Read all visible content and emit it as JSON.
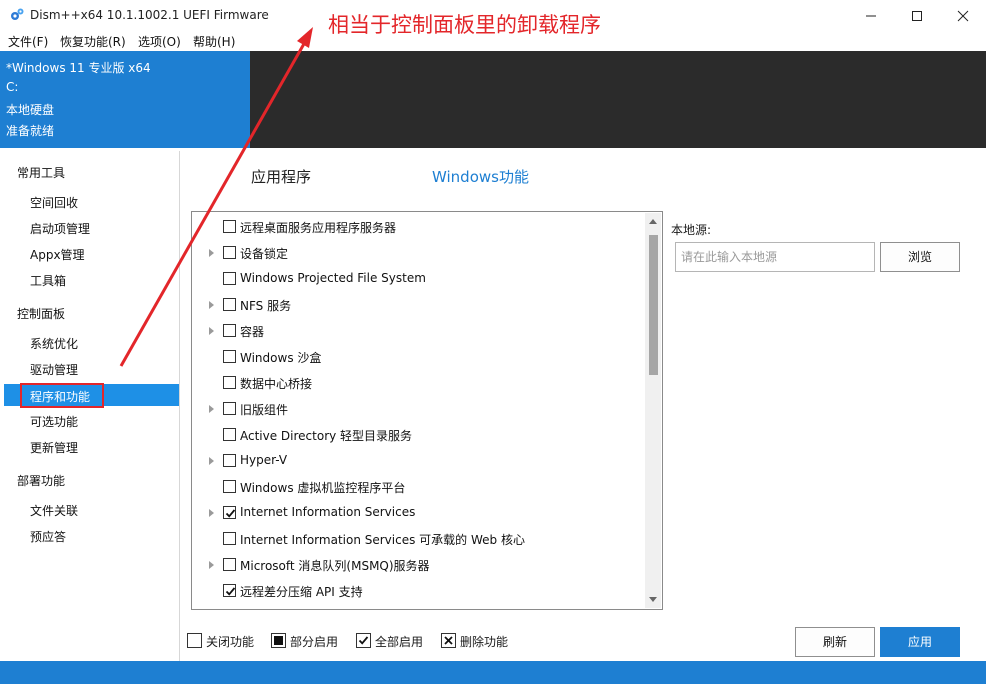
{
  "window": {
    "title": "Dism++x64 10.1.1002.1 UEFI Firmware",
    "icon": "gear-icon"
  },
  "menu": [
    "文件(F)",
    "恢复功能(R)",
    "选项(O)",
    "帮助(H)"
  ],
  "system_info": {
    "os": "*Windows 11 专业版 x64",
    "drive": "C:",
    "disk_type": "本地硬盘",
    "status": "准备就绪"
  },
  "sidebar": {
    "groups": [
      {
        "title": "常用工具",
        "items": [
          "空间回收",
          "启动项管理",
          "Appx管理",
          "工具箱"
        ]
      },
      {
        "title": "控制面板",
        "items": [
          "系统优化",
          "驱动管理",
          "程序和功能",
          "可选功能",
          "更新管理"
        ]
      },
      {
        "title": "部署功能",
        "items": [
          "文件关联",
          "预应答"
        ]
      }
    ],
    "active_item": "程序和功能"
  },
  "tabs": {
    "apps": "应用程序",
    "windows_features": "Windows功能"
  },
  "features": [
    {
      "label": "远程桌面服务应用程序服务器",
      "expandable": false,
      "state": "off"
    },
    {
      "label": "设备锁定",
      "expandable": true,
      "state": "off"
    },
    {
      "label": "Windows Projected File System",
      "expandable": false,
      "state": "off"
    },
    {
      "label": "NFS 服务",
      "expandable": true,
      "state": "off"
    },
    {
      "label": "容器",
      "expandable": true,
      "state": "off"
    },
    {
      "label": "Windows 沙盒",
      "expandable": false,
      "state": "off"
    },
    {
      "label": "数据中心桥接",
      "expandable": false,
      "state": "off"
    },
    {
      "label": "旧版组件",
      "expandable": true,
      "state": "off"
    },
    {
      "label": "Active Directory 轻型目录服务",
      "expandable": false,
      "state": "off"
    },
    {
      "label": "Hyper-V",
      "expandable": true,
      "state": "off"
    },
    {
      "label": "Windows 虚拟机监控程序平台",
      "expandable": false,
      "state": "off"
    },
    {
      "label": "Internet Information Services",
      "expandable": true,
      "state": "on"
    },
    {
      "label": "Internet Information Services 可承载的 Web 核心",
      "expandable": false,
      "state": "off"
    },
    {
      "label": "Microsoft 消息队列(MSMQ)服务器",
      "expandable": true,
      "state": "off"
    },
    {
      "label": "远程差分压缩 API 支持",
      "expandable": false,
      "state": "on"
    }
  ],
  "local_source": {
    "label": "本地源:",
    "placeholder": "请在此输入本地源",
    "browse_label": "浏览"
  },
  "legend": {
    "off": "关闭功能",
    "partial": "部分启用",
    "on": "全部启用",
    "remove": "删除功能"
  },
  "actions": {
    "refresh": "刷新",
    "apply": "应用"
  },
  "annotation": "相当于控制面板里的卸载程序",
  "colors": {
    "accent": "#1e7fd2",
    "active_item": "#1e90e6",
    "dark_panel": "#2b2b2b",
    "annotation": "#e3262a"
  }
}
